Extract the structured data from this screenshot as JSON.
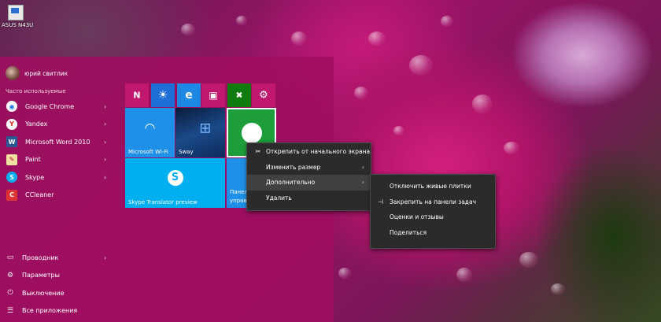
{
  "desktop": {
    "icon_label": "ASUS N43U"
  },
  "start_menu": {
    "user_name": "юрий свитлик",
    "frequent_header": "Часто используемые",
    "apps": [
      {
        "label": "Google Chrome",
        "icon": "chrome-icon",
        "color": "#ffffff",
        "glyph": "◉"
      },
      {
        "label": "Yandex",
        "icon": "yandex-icon",
        "color": "#ffffff",
        "glyph": "Y"
      },
      {
        "label": "Microsoft Word 2010",
        "icon": "word-icon",
        "color": "#2b5797",
        "glyph": "W"
      },
      {
        "label": "Paint",
        "icon": "paint-icon",
        "color": "#f0e0a0",
        "glyph": "✎"
      },
      {
        "label": "Skype",
        "icon": "skype-icon",
        "color": "#00aff0",
        "glyph": "S"
      },
      {
        "label": "CCleaner",
        "icon": "ccleaner-icon",
        "color": "#d33",
        "glyph": "C"
      }
    ],
    "system": [
      {
        "label": "Проводник",
        "glyph": "▭"
      },
      {
        "label": "Параметры",
        "glyph": "⚙"
      },
      {
        "label": "Выключение",
        "glyph": "⏻"
      },
      {
        "label": "Все приложения",
        "glyph": "☰"
      }
    ]
  },
  "tiles": {
    "wifi_label": "Microsoft Wi-Fi",
    "sway_label": "Sway",
    "skype_translator_label": "Skype Translator preview",
    "panel_label_line1": "Панел",
    "panel_label_line2": "управ"
  },
  "context_menu": {
    "items": [
      "Открепить от начального экрана",
      "Изменить размер",
      "Дополнительно",
      "Удалить"
    ]
  },
  "submenu": {
    "items": [
      "Отключить живые плитки",
      "Закрепить на панели задач",
      "Оценки и отзывы",
      "Поделиться"
    ]
  },
  "colors": {
    "start_bg": "#a00e60",
    "accent_tile": "#1e90e8",
    "small_tile_pink": "#c0186f",
    "green_tile": "#1e9e3a",
    "menu_bg": "#2b2b2b"
  }
}
